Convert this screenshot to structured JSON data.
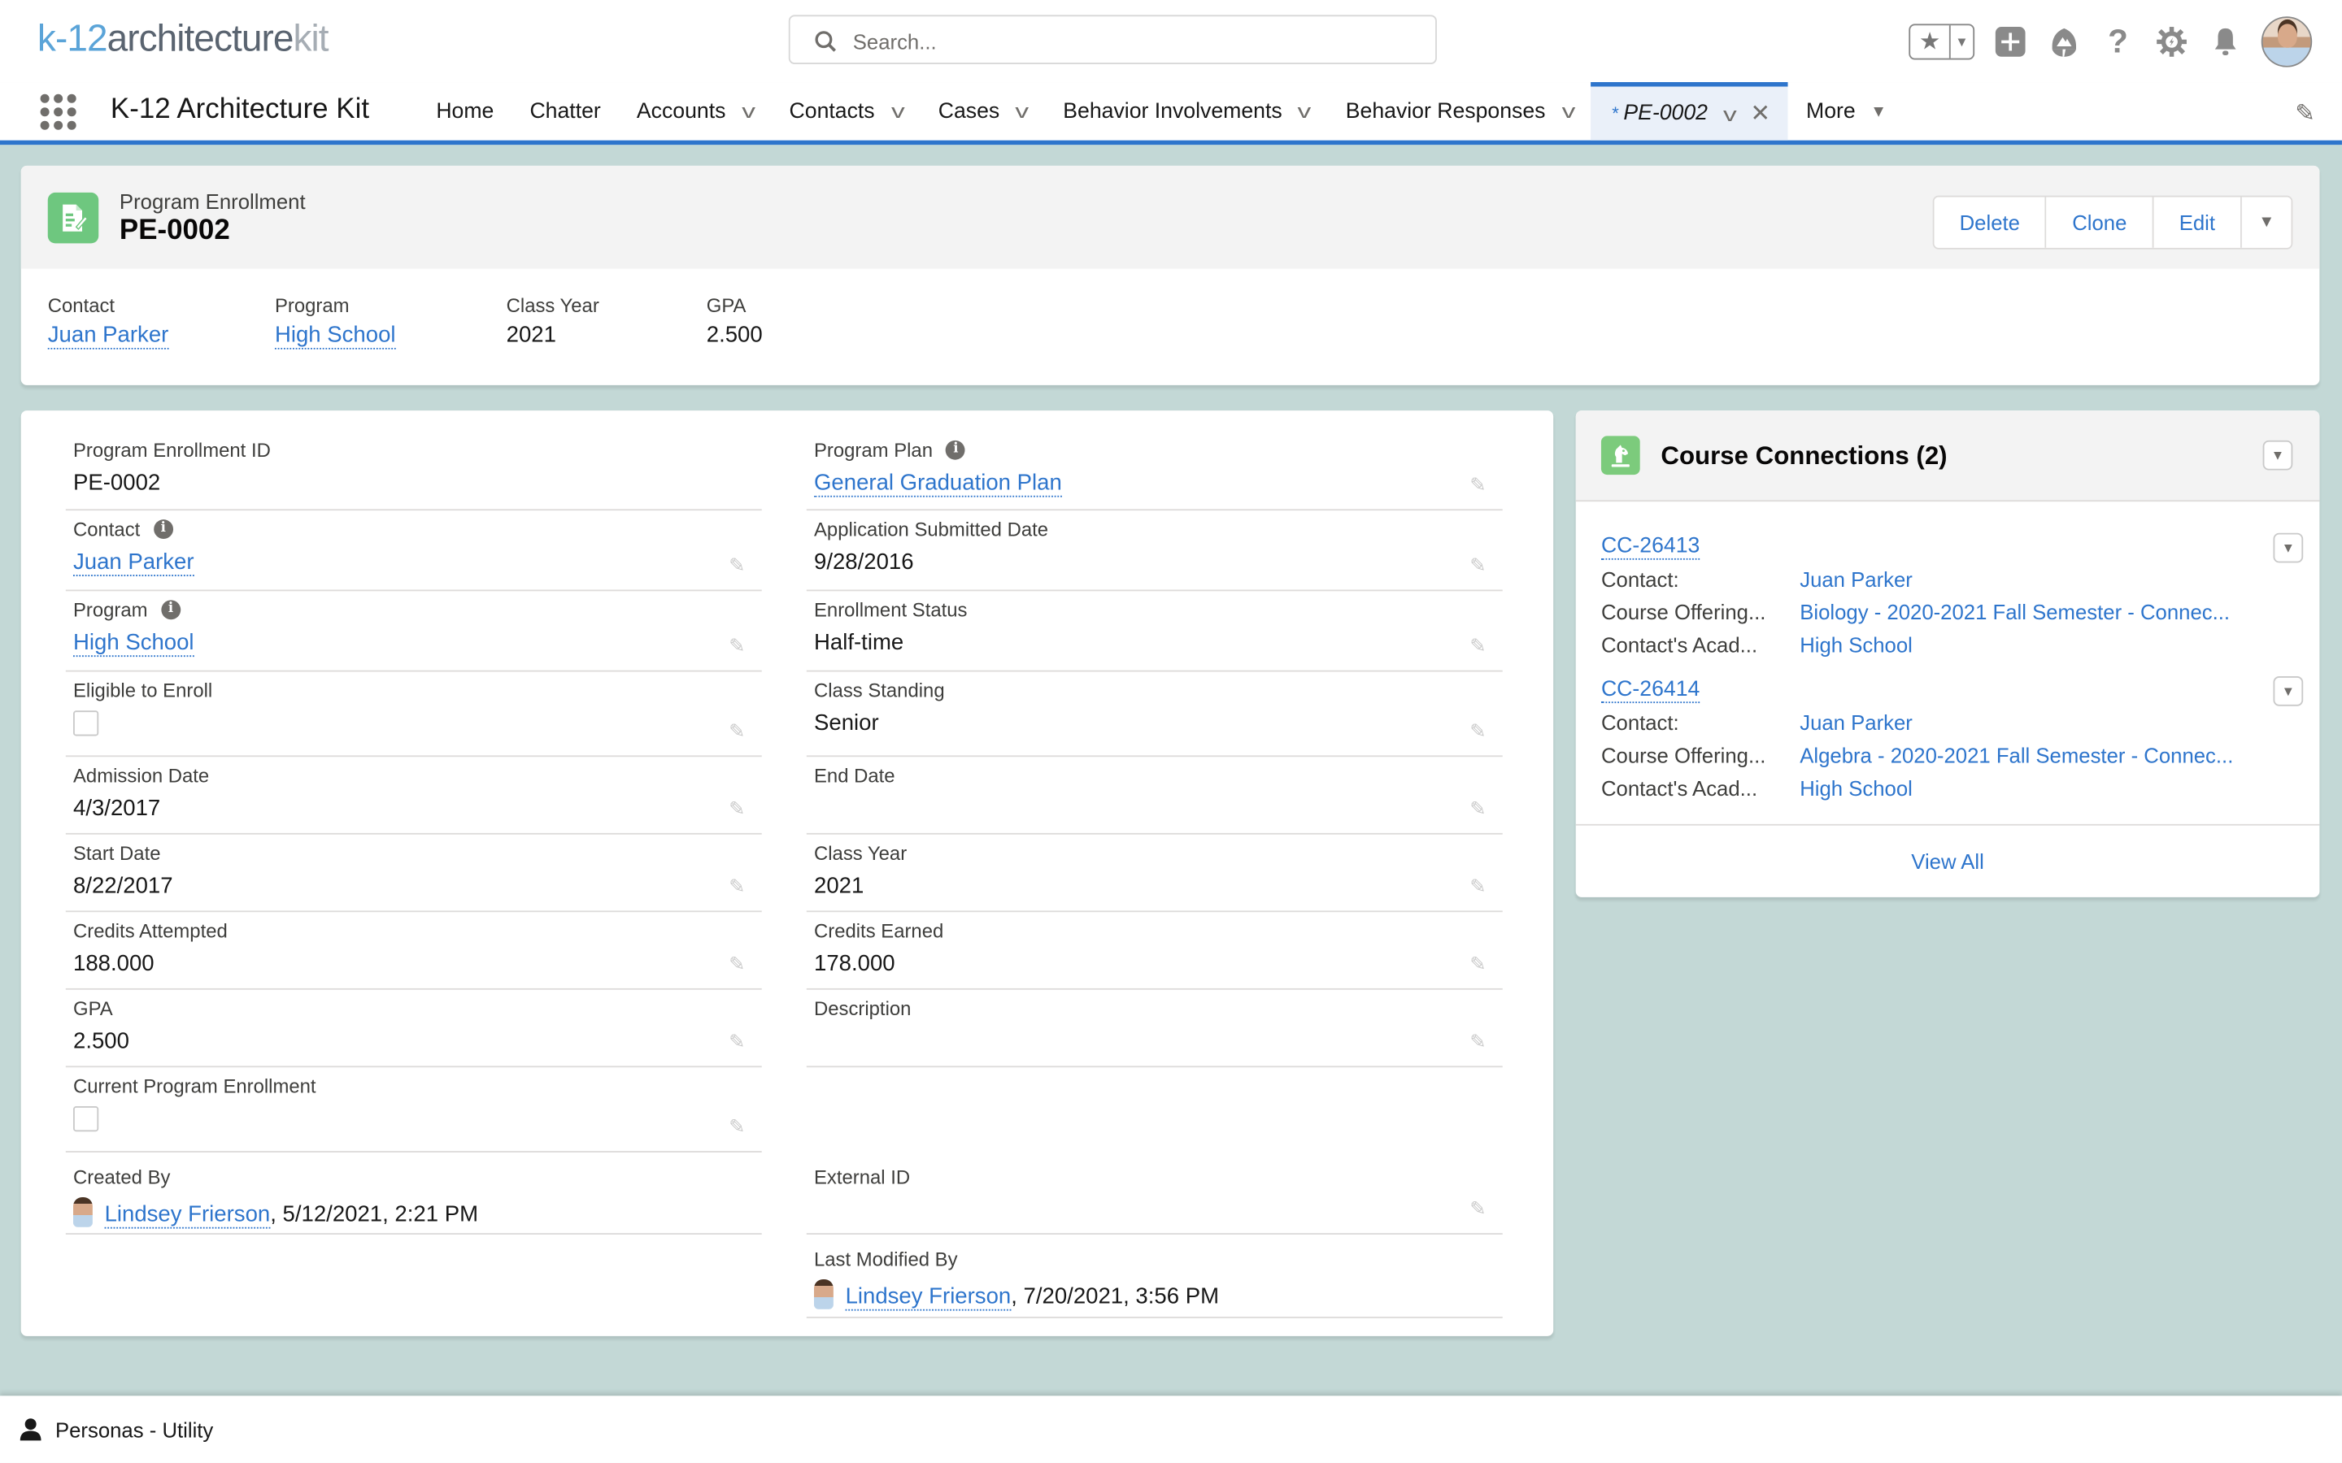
{
  "header": {
    "logo": {
      "part1": "k-12",
      "part2": "architecture",
      "part3": "kit"
    },
    "search": {
      "placeholder": "Search...",
      "value": ""
    },
    "icons": [
      "favorites-star-icon",
      "favorites-dropdown-icon",
      "global-add-icon",
      "trailhead-icon",
      "help-icon",
      "setup-gear-icon",
      "notifications-bell-icon",
      "user-avatar"
    ]
  },
  "nav": {
    "app_name": "K-12 Architecture Kit",
    "tabs": [
      {
        "label": "Home",
        "dropdown": false
      },
      {
        "label": "Chatter",
        "dropdown": false
      },
      {
        "label": "Accounts",
        "dropdown": true
      },
      {
        "label": "Contacts",
        "dropdown": true
      },
      {
        "label": "Cases",
        "dropdown": true
      },
      {
        "label": "Behavior Involvements",
        "dropdown": true
      },
      {
        "label": "Behavior Responses",
        "dropdown": true
      }
    ],
    "active_tab": {
      "prefix": "*",
      "label": "PE-0002"
    },
    "more_label": "More"
  },
  "highlights": {
    "object_type": "Program Enrollment",
    "record_name": "PE-0002",
    "buttons": {
      "delete": "Delete",
      "clone": "Clone",
      "edit": "Edit"
    },
    "fields": [
      {
        "label": "Contact",
        "value": "Juan Parker",
        "link": true
      },
      {
        "label": "Program",
        "value": "High School",
        "link": true
      },
      {
        "label": "Class Year",
        "value": "2021",
        "link": false
      },
      {
        "label": "GPA",
        "value": "2.500",
        "link": false
      }
    ]
  },
  "details": {
    "left": [
      {
        "label": "Program Enrollment ID",
        "value": "PE-0002",
        "type": "text",
        "editable": false
      },
      {
        "label": "Contact",
        "value": "Juan Parker",
        "type": "link",
        "info": true,
        "editable": true
      },
      {
        "label": "Program",
        "value": "High School",
        "type": "link",
        "info": true,
        "editable": true
      },
      {
        "label": "Eligible to Enroll",
        "value": false,
        "type": "checkbox",
        "editable": true
      },
      {
        "label": "Admission Date",
        "value": "4/3/2017",
        "type": "text",
        "editable": true
      },
      {
        "label": "Start Date",
        "value": "8/22/2017",
        "type": "text",
        "editable": true
      },
      {
        "label": "Credits Attempted",
        "value": "188.000",
        "type": "text",
        "editable": true
      },
      {
        "label": "GPA",
        "value": "2.500",
        "type": "text",
        "editable": true
      },
      {
        "label": "Current Program Enrollment",
        "value": false,
        "type": "checkbox",
        "editable": true
      },
      {
        "label": "Created By",
        "user": "Lindsey Frierson",
        "timestamp": ", 5/12/2021, 2:21 PM",
        "type": "user"
      }
    ],
    "right": [
      {
        "label": "Program Plan",
        "value": "General Graduation Plan",
        "type": "link",
        "info": true,
        "editable": true
      },
      {
        "label": "Application Submitted Date",
        "value": "9/28/2016",
        "type": "text",
        "editable": true
      },
      {
        "label": "Enrollment Status",
        "value": "Half-time",
        "type": "text",
        "editable": true
      },
      {
        "label": "Class Standing",
        "value": "Senior",
        "type": "text",
        "editable": true
      },
      {
        "label": "End Date",
        "value": "",
        "type": "text",
        "editable": true
      },
      {
        "label": "Class Year",
        "value": "2021",
        "type": "text",
        "editable": true
      },
      {
        "label": "Credits Earned",
        "value": "178.000",
        "type": "text",
        "editable": true
      },
      {
        "label": "Description",
        "value": "",
        "type": "text",
        "editable": true
      },
      {
        "label": "External ID",
        "value": "",
        "type": "text",
        "editable": true
      },
      {
        "label": "Last Modified By",
        "user": "Lindsey Frierson",
        "timestamp": ", 7/20/2021, 3:56 PM",
        "type": "user"
      }
    ]
  },
  "related": {
    "title": "Course Connections (2)",
    "records": [
      {
        "id": "CC-26413",
        "rows": [
          {
            "key": "Contact:",
            "value": "Juan Parker"
          },
          {
            "key": "Course Offering...",
            "value": "Biology - 2020-2021 Fall Semester - Connec..."
          },
          {
            "key": "Contact's Acad...",
            "value": "High School"
          }
        ]
      },
      {
        "id": "CC-26414",
        "rows": [
          {
            "key": "Contact:",
            "value": "Juan Parker"
          },
          {
            "key": "Course Offering...",
            "value": "Algebra - 2020-2021 Fall Semester - Connec..."
          },
          {
            "key": "Contact's Acad...",
            "value": "High School"
          }
        ]
      }
    ],
    "view_all": "View All"
  },
  "utility_bar": {
    "item": "Personas - Utility"
  },
  "colors": {
    "brand_blue": "#2e75cc",
    "record_icon_green": "#6ec77f",
    "page_bg": "#c3d8d6"
  }
}
